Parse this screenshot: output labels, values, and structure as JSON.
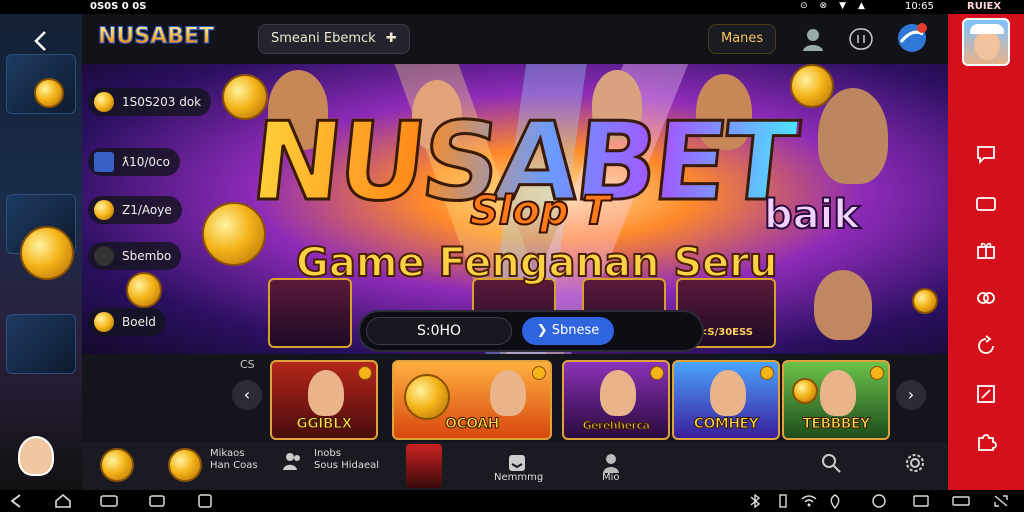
{
  "statusbar": {
    "time": "0S0S 0 0S",
    "icons": [
      "⊙",
      "⊗",
      "▼",
      "▲"
    ],
    "battery": "10:65",
    "rail_label": "RUIEX"
  },
  "topbar": {
    "logo": "NUSABET",
    "search_chip": "Smeani Ebemck",
    "search_chip_icon": "plus-icon",
    "mores_label": "Manes"
  },
  "hero": {
    "title": "NUSABET",
    "slot_text": "Slop T",
    "baik_text": "baik",
    "subtitle": "Game Fenganan Seru",
    "side_pills": [
      {
        "label": "1S0S203 dok",
        "icon": "coin"
      },
      {
        "label": "ƛ10/0co",
        "icon": "blue"
      },
      {
        "label": "Z1/Aoye",
        "icon": "coin"
      },
      {
        "label": "Sbembo",
        "icon": "dark"
      },
      {
        "label": "Boeld",
        "icon": "coin"
      }
    ],
    "mini_tiles": [
      "",
      "",
      "",
      "<S/30ESS"
    ],
    "search_value": "S:0HO",
    "search_button": "Sbnese"
  },
  "carousel": {
    "tab_label": "CS",
    "games": [
      {
        "label": "GGIBLX",
        "bg": "#7a1414"
      },
      {
        "label": "OCOAH",
        "bg": "#e06a12"
      },
      {
        "label": "Gerehherca",
        "bg": "#4c1a66"
      },
      {
        "label": "COMHEY",
        "bg": "#1f5fb5"
      },
      {
        "label": "TEBBBEY",
        "bg": "#2f6b2a"
      }
    ]
  },
  "bottomnav": {
    "items": [
      {
        "line1": "Mikaos",
        "line2": "Han Coas"
      },
      {
        "line1": "Inobs",
        "line2": "Sous Hidaeal"
      },
      {
        "line1": "",
        "line2": "Nemmmg"
      },
      {
        "line1": "",
        "line2": "Mio"
      }
    ]
  },
  "colors": {
    "accent_red": "#d5101a",
    "coin_gold": "#f4b419",
    "button_blue": "#2f66e0"
  }
}
